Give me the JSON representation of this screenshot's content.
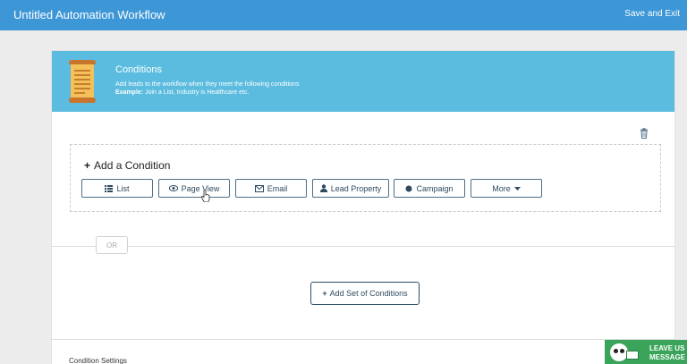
{
  "topbar": {
    "title": "Untitled Automation Workflow",
    "save_exit": "Save and Exit",
    "color": "#3d96d6"
  },
  "header": {
    "title": "Conditions",
    "description": "Add leads to the workflow when they meet the following conditions",
    "example_label": "Example:",
    "example_text": " Join a List, Industry is Healthcare etc.",
    "icon": "scroll-icon",
    "color": "#5bbcdf"
  },
  "condition_box": {
    "add_title": "Add a Condition",
    "buttons": {
      "list": {
        "label": "List",
        "icon": "list-icon"
      },
      "page_view": {
        "label": "Page View",
        "icon": "eye-icon"
      },
      "email": {
        "label": "Email",
        "icon": "envelope-icon"
      },
      "lead_property": {
        "label": "Lead Property",
        "icon": "user-icon"
      },
      "campaign": {
        "label": "Campaign",
        "icon": "circle-icon"
      },
      "more": {
        "label": "More",
        "icon": "caret-down-icon"
      }
    }
  },
  "or_label": "OR",
  "add_set_label": "Add Set of Conditions",
  "condition_settings_label": "Condition Settings",
  "chat_widget": {
    "line1": "LEAVE US",
    "line2": "MESSAGE",
    "color": "#3aa55a"
  }
}
